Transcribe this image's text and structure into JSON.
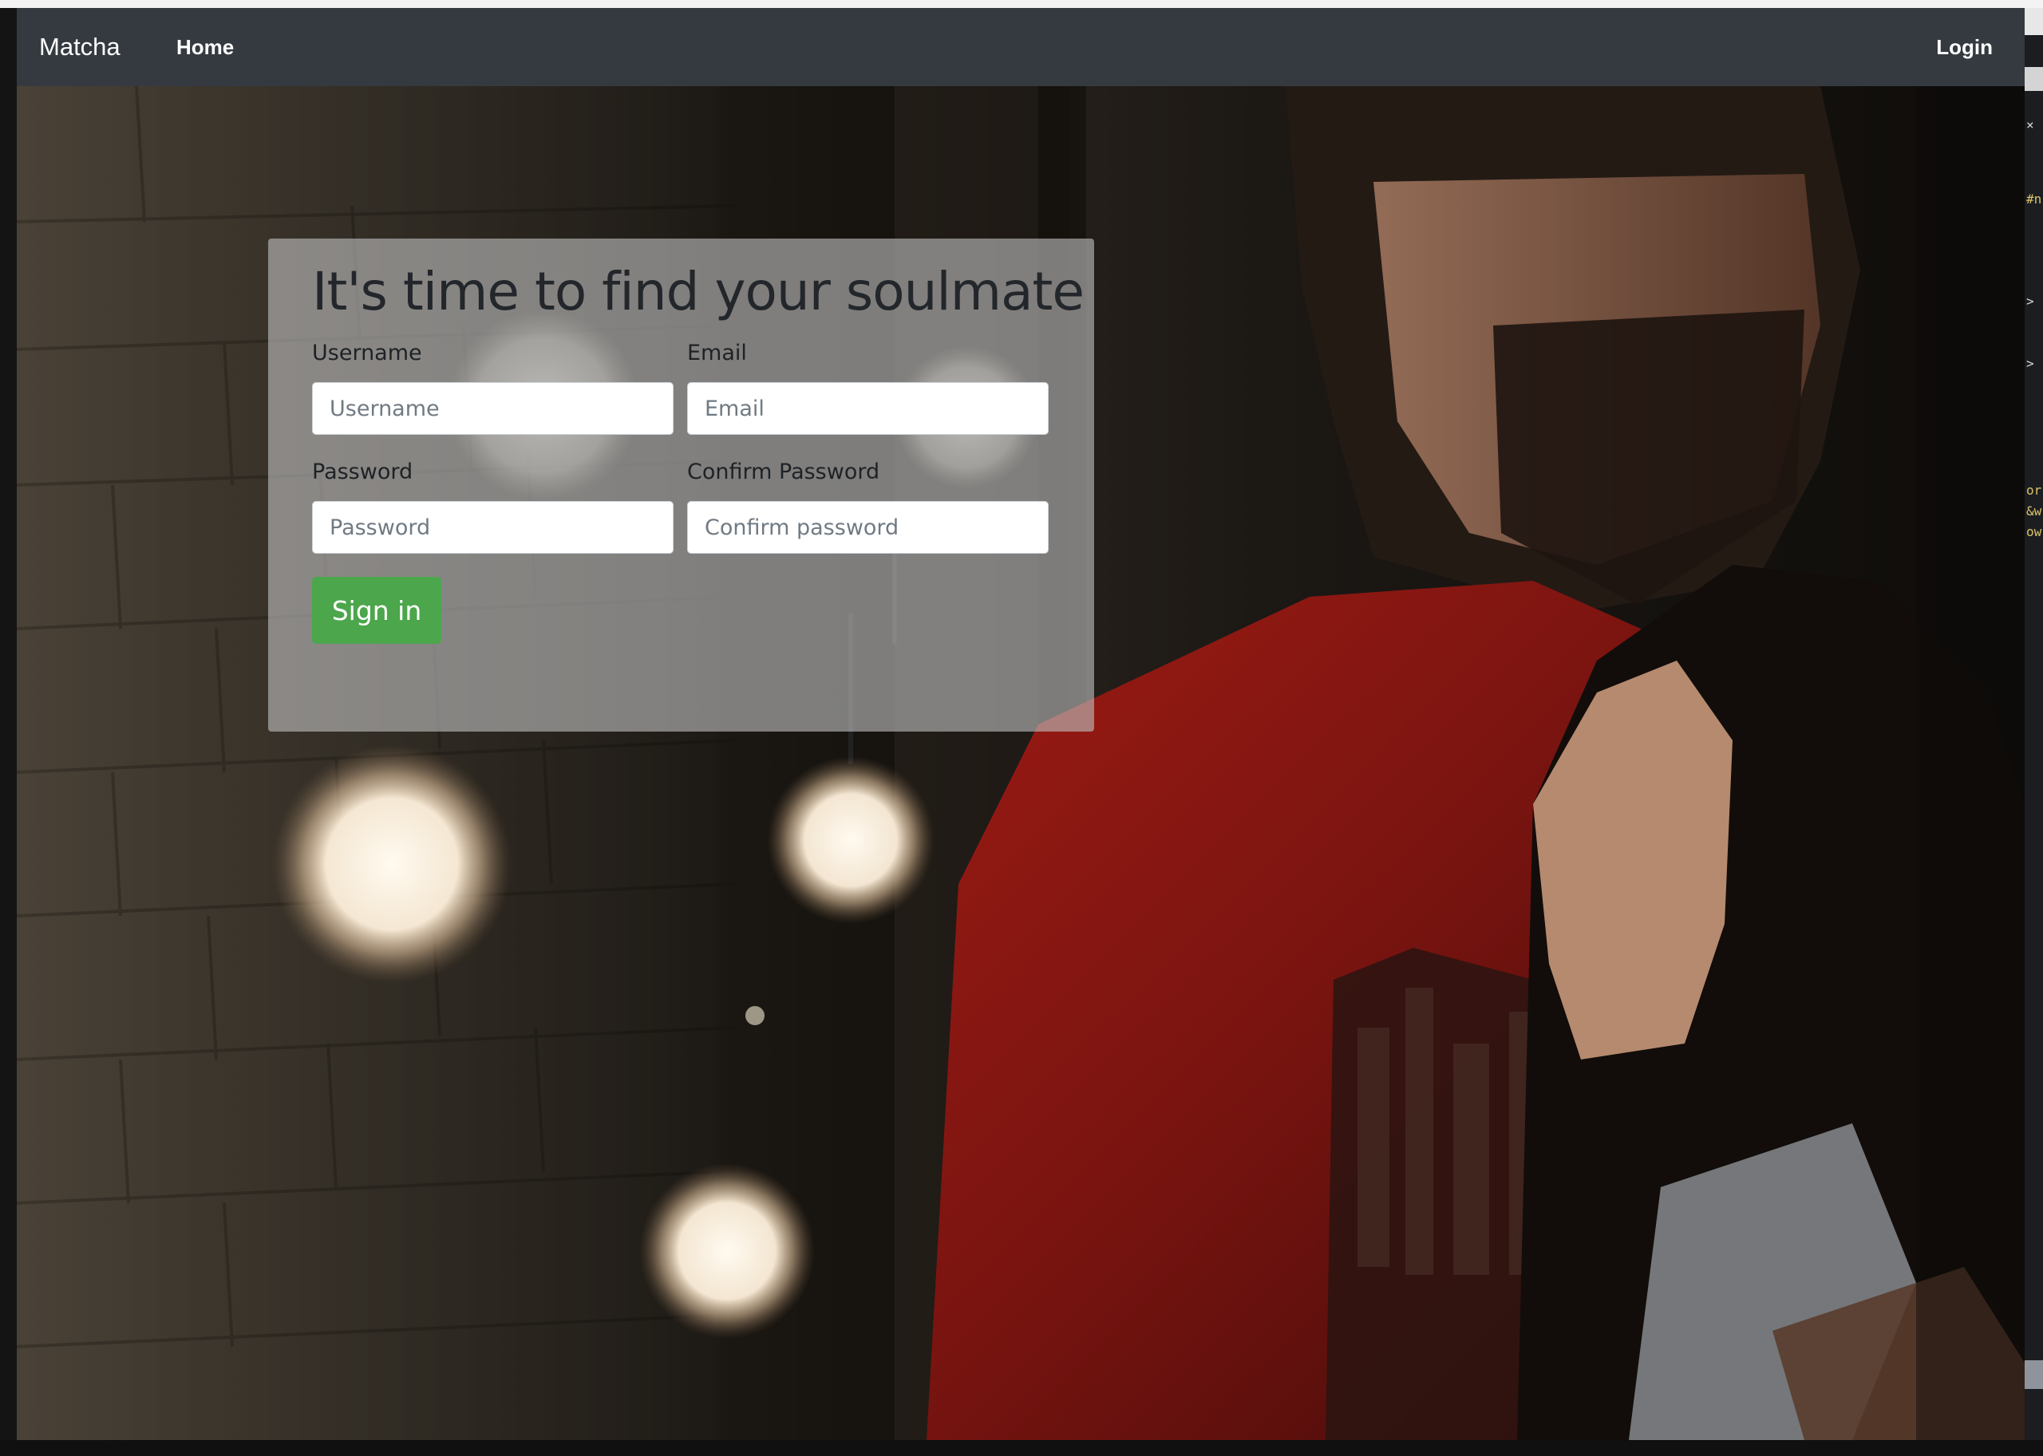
{
  "navbar": {
    "brand": "Matcha",
    "home": "Home",
    "login": "Login"
  },
  "signup": {
    "title": "It's time to find your soulmate",
    "username_label": "Username",
    "username_placeholder": "Username",
    "email_label": "Email",
    "email_placeholder": "Email",
    "password_label": "Password",
    "password_placeholder": "Password",
    "confirm_label": "Confirm Password",
    "confirm_placeholder": "Confirm password",
    "submit_label": "Sign in"
  },
  "editor_strip": {
    "lines": [
      "#n",
      ">",
      ">",
      "or",
      "&w",
      "ow"
    ]
  },
  "colors": {
    "navbar_bg": "#343a40",
    "button_bg": "#4ca64c",
    "card_overlay": "rgba(190,190,190,0.62)"
  }
}
